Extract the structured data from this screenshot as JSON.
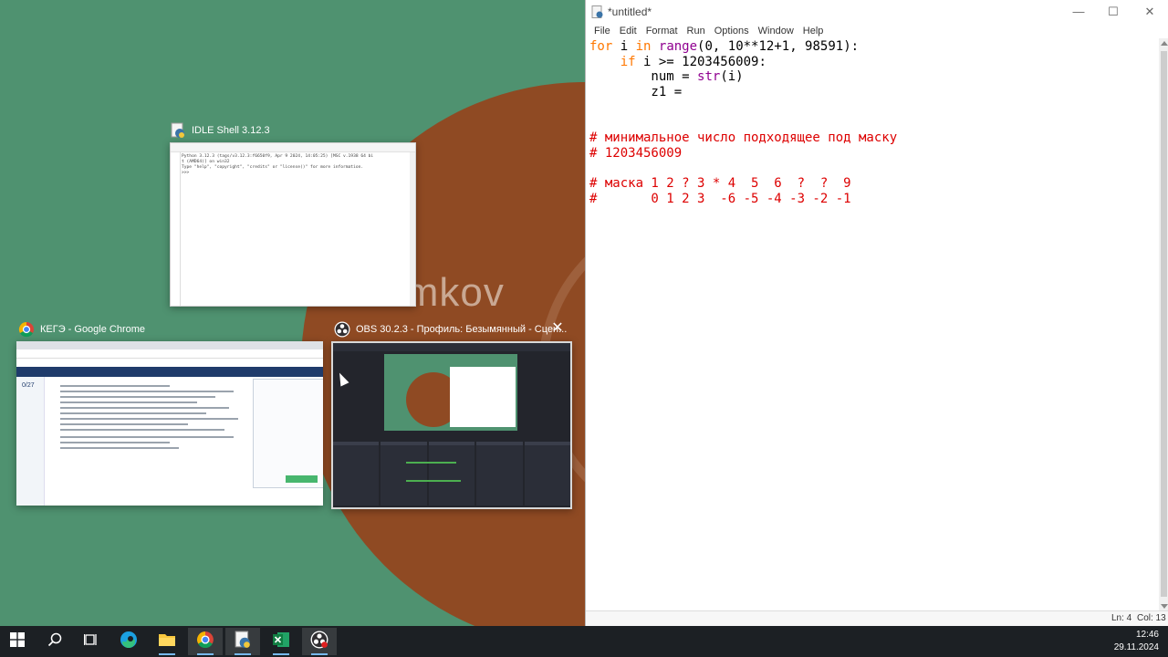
{
  "desktop": {
    "wallpaper_text": "kimkov"
  },
  "task_view": {
    "idle_shell": {
      "title": "IDLE Shell 3.12.3",
      "lines": [
        "Python 3.12.3 (tags/v3.12.3:f6650f9, Apr  9 2024, 14:05:25) [MSC v.1938 64 bi",
        "t (AMD64)] on win32",
        "Type \"help\", \"copyright\", \"credits\" or \"license()\" for more information.",
        ">>>"
      ]
    },
    "chrome": {
      "title": "КЕГЭ - Google Chrome",
      "counter": "0/27"
    },
    "obs": {
      "title": "OBS 30.2.3 - Профиль: Безымянный - Сцен...",
      "close_label": "✕"
    }
  },
  "editor": {
    "title": "*untitled*",
    "menu": [
      "File",
      "Edit",
      "Format",
      "Run",
      "Options",
      "Window",
      "Help"
    ],
    "window_controls": {
      "minimize": "—",
      "maximize": "☐",
      "close": "✕"
    },
    "code": [
      [
        {
          "t": "for",
          "c": "kw"
        },
        {
          "t": " i "
        },
        {
          "t": "in",
          "c": "kw"
        },
        {
          "t": " "
        },
        {
          "t": "range",
          "c": "bi"
        },
        {
          "t": "(0, 10**12+1, 98591):"
        }
      ],
      [
        {
          "t": "    "
        },
        {
          "t": "if",
          "c": "kw"
        },
        {
          "t": " i >= 1203456009:"
        }
      ],
      [
        {
          "t": "        num = "
        },
        {
          "t": "str",
          "c": "bi"
        },
        {
          "t": "(i)"
        }
      ],
      [
        {
          "t": "        z1 = "
        }
      ],
      [],
      [],
      [
        {
          "t": "# минимальное число подходящее под маску",
          "c": "cm"
        }
      ],
      [
        {
          "t": "# 1203456009",
          "c": "cm"
        }
      ],
      [],
      [
        {
          "t": "# маска 1 2 ? 3 * 4  5  6  ?  ?  9",
          "c": "cm"
        }
      ],
      [
        {
          "t": "#       0 1 2 3  -6 -5 -4 -3 -2 -1",
          "c": "cm"
        }
      ]
    ],
    "status": {
      "line": "Ln: 4",
      "col": "Col: 13"
    }
  },
  "taskbar": {
    "items": [
      {
        "name": "start-button",
        "icon": "windows-logo-icon"
      },
      {
        "name": "search-button",
        "icon": "search-icon"
      },
      {
        "name": "task-view-button",
        "icon": "task-view-icon"
      },
      {
        "name": "edge-button",
        "icon": "edge-icon"
      },
      {
        "name": "file-explorer-button",
        "icon": "folder-icon"
      },
      {
        "name": "chrome-button",
        "icon": "chrome-icon"
      },
      {
        "name": "idle-button",
        "icon": "python-idle-icon"
      },
      {
        "name": "excel-button",
        "icon": "excel-icon"
      },
      {
        "name": "obs-button",
        "icon": "obs-icon"
      }
    ],
    "time": "12:46",
    "date": "29.11.2024"
  },
  "colors": {
    "keyword": "#ff7700",
    "builtin": "#900090",
    "comment": "#dd0000",
    "wallpaper_green": "#4f9270",
    "wallpaper_brown": "#8f4a23",
    "taskbar": "#1c2024"
  }
}
